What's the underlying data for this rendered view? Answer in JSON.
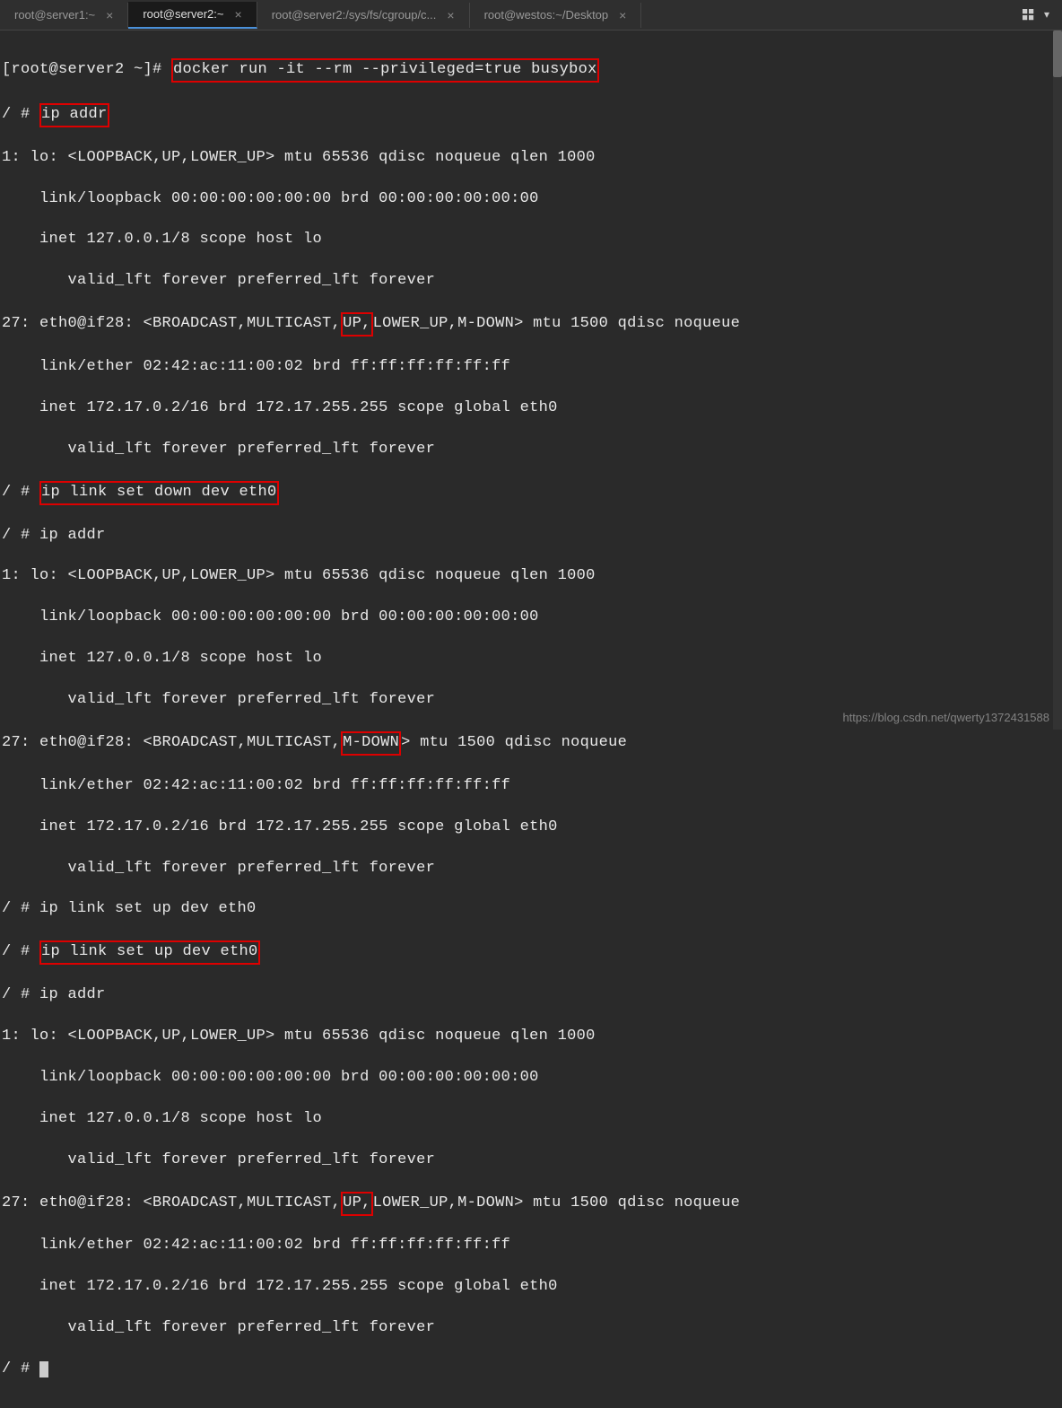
{
  "tabs": {
    "t1": "root@server1:~",
    "t2": "root@server2:~",
    "t3": "root@server2:/sys/fs/cgroup/c...",
    "t4": "root@westos:~/Desktop"
  },
  "term": {
    "prompt1": "[root@server2 ~]# ",
    "cmd_docker": "docker run -it --rm --privileged=true busybox",
    "shellprompt": "/ # ",
    "cmd_ipaddr": "ip addr",
    "lo_header": "1: lo: <LOOPBACK,UP,LOWER_UP> mtu 65536 qdisc noqueue qlen 1000",
    "lo_link": "    link/loopback 00:00:00:00:00:00 brd 00:00:00:00:00:00",
    "lo_inet": "    inet 127.0.0.1/8 scope host lo",
    "lo_valid": "       valid_lft forever preferred_lft forever",
    "eth_pre1": "27: eth0@if28: <BROADCAST,MULTICAST,",
    "eth_up": "UP,",
    "eth_post1": "LOWER_UP,M-DOWN> mtu 1500 qdisc noqueue",
    "eth_link": "    link/ether 02:42:ac:11:00:02 brd ff:ff:ff:ff:ff:ff",
    "eth_inet": "    inet 172.17.0.2/16 brd 172.17.255.255 scope global eth0",
    "eth_valid": "       valid_lft forever preferred_lft forever",
    "cmd_linkdown": "ip link set down dev eth0",
    "cmd_ipaddr2": "/ # ip addr",
    "eth_pre2": "27: eth0@if28: <BROADCAST,MULTICAST,",
    "eth_mdown": "M-DOWN",
    "eth_post2": "> mtu 1500 qdisc noqueue",
    "cmd_linkup1": "/ # ip link set up dev eth0",
    "cmd_linkup2": "ip link set up dev eth0",
    "cmd_ipaddr3": "/ # ip addr",
    "eth_pre3": "27: eth0@if28: <BROADCAST,MULTICAST,",
    "eth_up3": "UP,",
    "eth_post3": "LOWER_UP,M-DOWN> mtu 1500 qdisc noqueue",
    "endprompt": "/ # "
  },
  "watermark": "https://blog.csdn.net/qwerty1372431588"
}
